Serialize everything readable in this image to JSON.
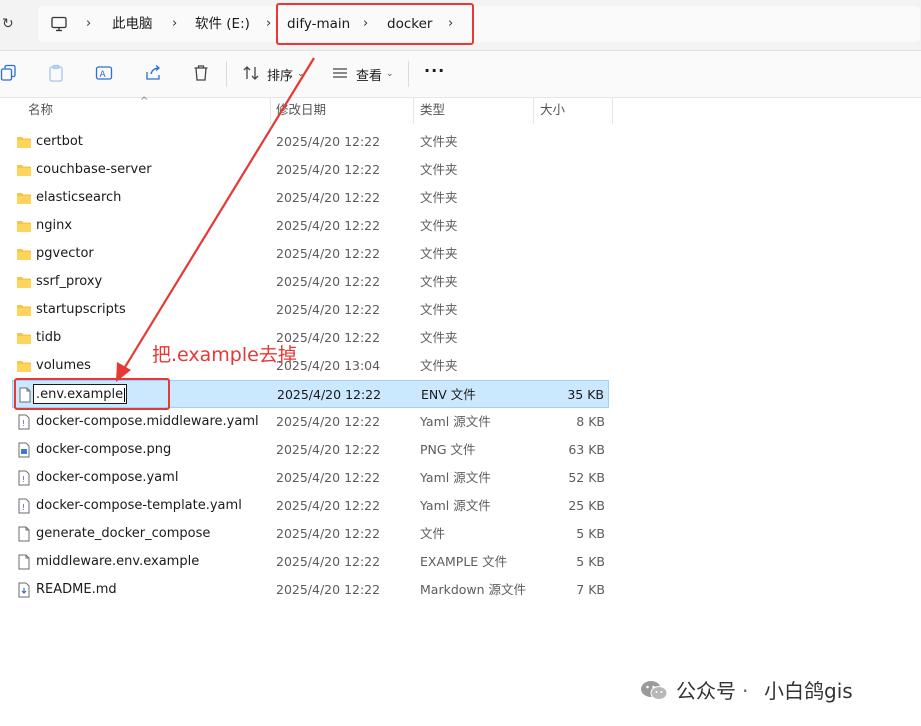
{
  "address": {
    "crumbs": [
      "此电脑",
      "软件 (E:)",
      "dify-main",
      "docker"
    ]
  },
  "toolbar": {
    "sort_label": "排序",
    "view_label": "查看",
    "more_label": "···"
  },
  "columns": {
    "name": "名称",
    "date": "修改日期",
    "type": "类型",
    "size": "大小"
  },
  "files": [
    {
      "name": "certbot",
      "date": "2025/4/20 12:22",
      "type": "文件夹",
      "size": "",
      "icon": "folder-icon"
    },
    {
      "name": "couchbase-server",
      "date": "2025/4/20 12:22",
      "type": "文件夹",
      "size": "",
      "icon": "folder-icon"
    },
    {
      "name": "elasticsearch",
      "date": "2025/4/20 12:22",
      "type": "文件夹",
      "size": "",
      "icon": "folder-icon"
    },
    {
      "name": "nginx",
      "date": "2025/4/20 12:22",
      "type": "文件夹",
      "size": "",
      "icon": "folder-icon"
    },
    {
      "name": "pgvector",
      "date": "2025/4/20 12:22",
      "type": "文件夹",
      "size": "",
      "icon": "folder-icon"
    },
    {
      "name": "ssrf_proxy",
      "date": "2025/4/20 12:22",
      "type": "文件夹",
      "size": "",
      "icon": "folder-icon"
    },
    {
      "name": "startupscripts",
      "date": "2025/4/20 12:22",
      "type": "文件夹",
      "size": "",
      "icon": "folder-icon"
    },
    {
      "name": "tidb",
      "date": "2025/4/20 12:22",
      "type": "文件夹",
      "size": "",
      "icon": "folder-icon"
    },
    {
      "name": "volumes",
      "date": "2025/4/20 13:04",
      "type": "文件夹",
      "size": "",
      "icon": "folder-icon"
    },
    {
      "name": ".env.example",
      "date": "2025/4/20 12:22",
      "type": "ENV 文件",
      "size": "35 KB",
      "icon": "file-icon"
    },
    {
      "name": "docker-compose.middleware.yaml",
      "date": "2025/4/20 12:22",
      "type": "Yaml 源文件",
      "size": "8 KB",
      "icon": "yaml-file-icon"
    },
    {
      "name": "docker-compose.png",
      "date": "2025/4/20 12:22",
      "type": "PNG 文件",
      "size": "63 KB",
      "icon": "image-file-icon"
    },
    {
      "name": "docker-compose.yaml",
      "date": "2025/4/20 12:22",
      "type": "Yaml 源文件",
      "size": "52 KB",
      "icon": "yaml-file-icon"
    },
    {
      "name": "docker-compose-template.yaml",
      "date": "2025/4/20 12:22",
      "type": "Yaml 源文件",
      "size": "25 KB",
      "icon": "yaml-file-icon"
    },
    {
      "name": "generate_docker_compose",
      "date": "2025/4/20 12:22",
      "type": "文件",
      "size": "5 KB",
      "icon": "file-icon"
    },
    {
      "name": "middleware.env.example",
      "date": "2025/4/20 12:22",
      "type": "EXAMPLE 文件",
      "size": "5 KB",
      "icon": "file-icon"
    },
    {
      "name": "README.md",
      "date": "2025/4/20 12:22",
      "type": "Markdown 源文件",
      "size": "7 KB",
      "icon": "markdown-file-icon"
    }
  ],
  "rename_value": ".env.example",
  "annotation": "把.example去掉",
  "watermark": {
    "brand": "公众号",
    "separator": "·",
    "author": "小白鸽gis"
  },
  "colors": {
    "annotation_red": "#e53935",
    "selection": "#cce8ff",
    "folder": "#f8c542"
  }
}
